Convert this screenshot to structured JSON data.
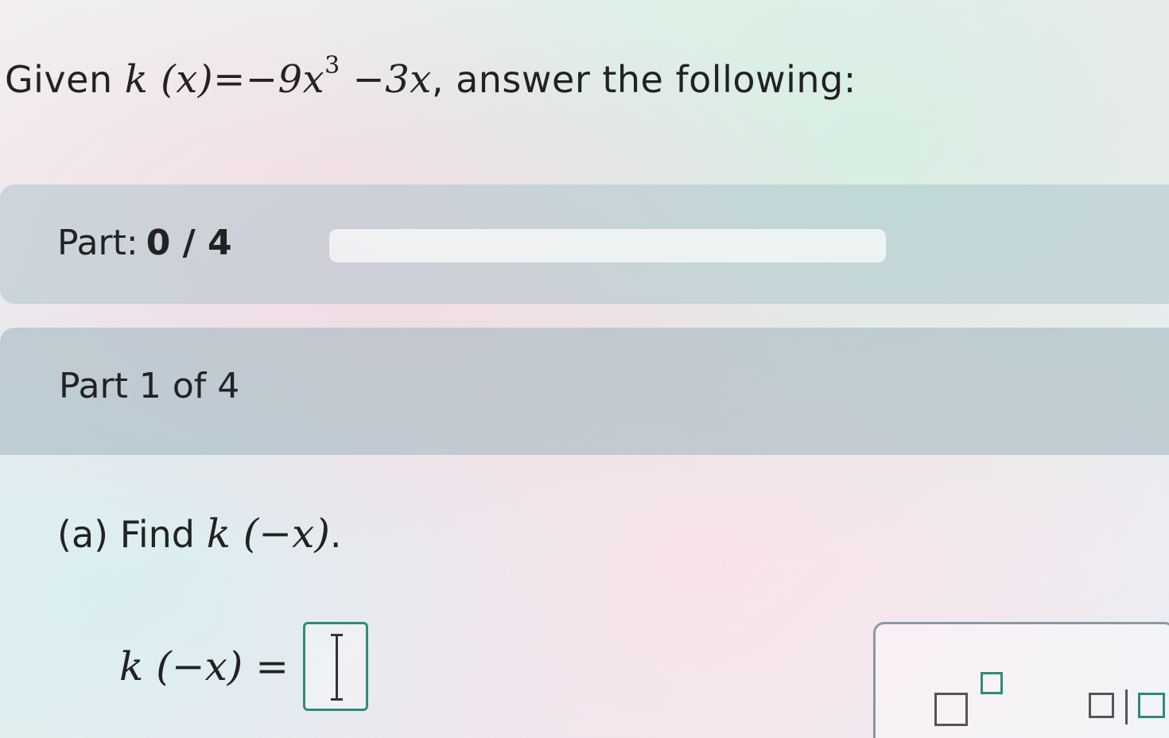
{
  "problem": {
    "prefix": "Given ",
    "function_lhs": "k (x)",
    "equals": "=",
    "term1_coef": "−9x",
    "term1_exp": "3",
    "term2": " −3x",
    "suffix": ", answer the following:"
  },
  "progress": {
    "label": "Part:",
    "value": "0 / 4",
    "completed": 0,
    "total": 4
  },
  "part": {
    "heading": "Part 1 of 4"
  },
  "question": {
    "prefix": "(a) Find ",
    "expression": "k (−x)",
    "suffix": "."
  },
  "answer": {
    "lhs": "k (−x) =",
    "value": ""
  },
  "toolbar": {
    "tools": [
      "superscript-tool",
      "fraction-tool"
    ]
  },
  "colors": {
    "accent": "#2f8b7c",
    "band": "#a0bec8"
  }
}
